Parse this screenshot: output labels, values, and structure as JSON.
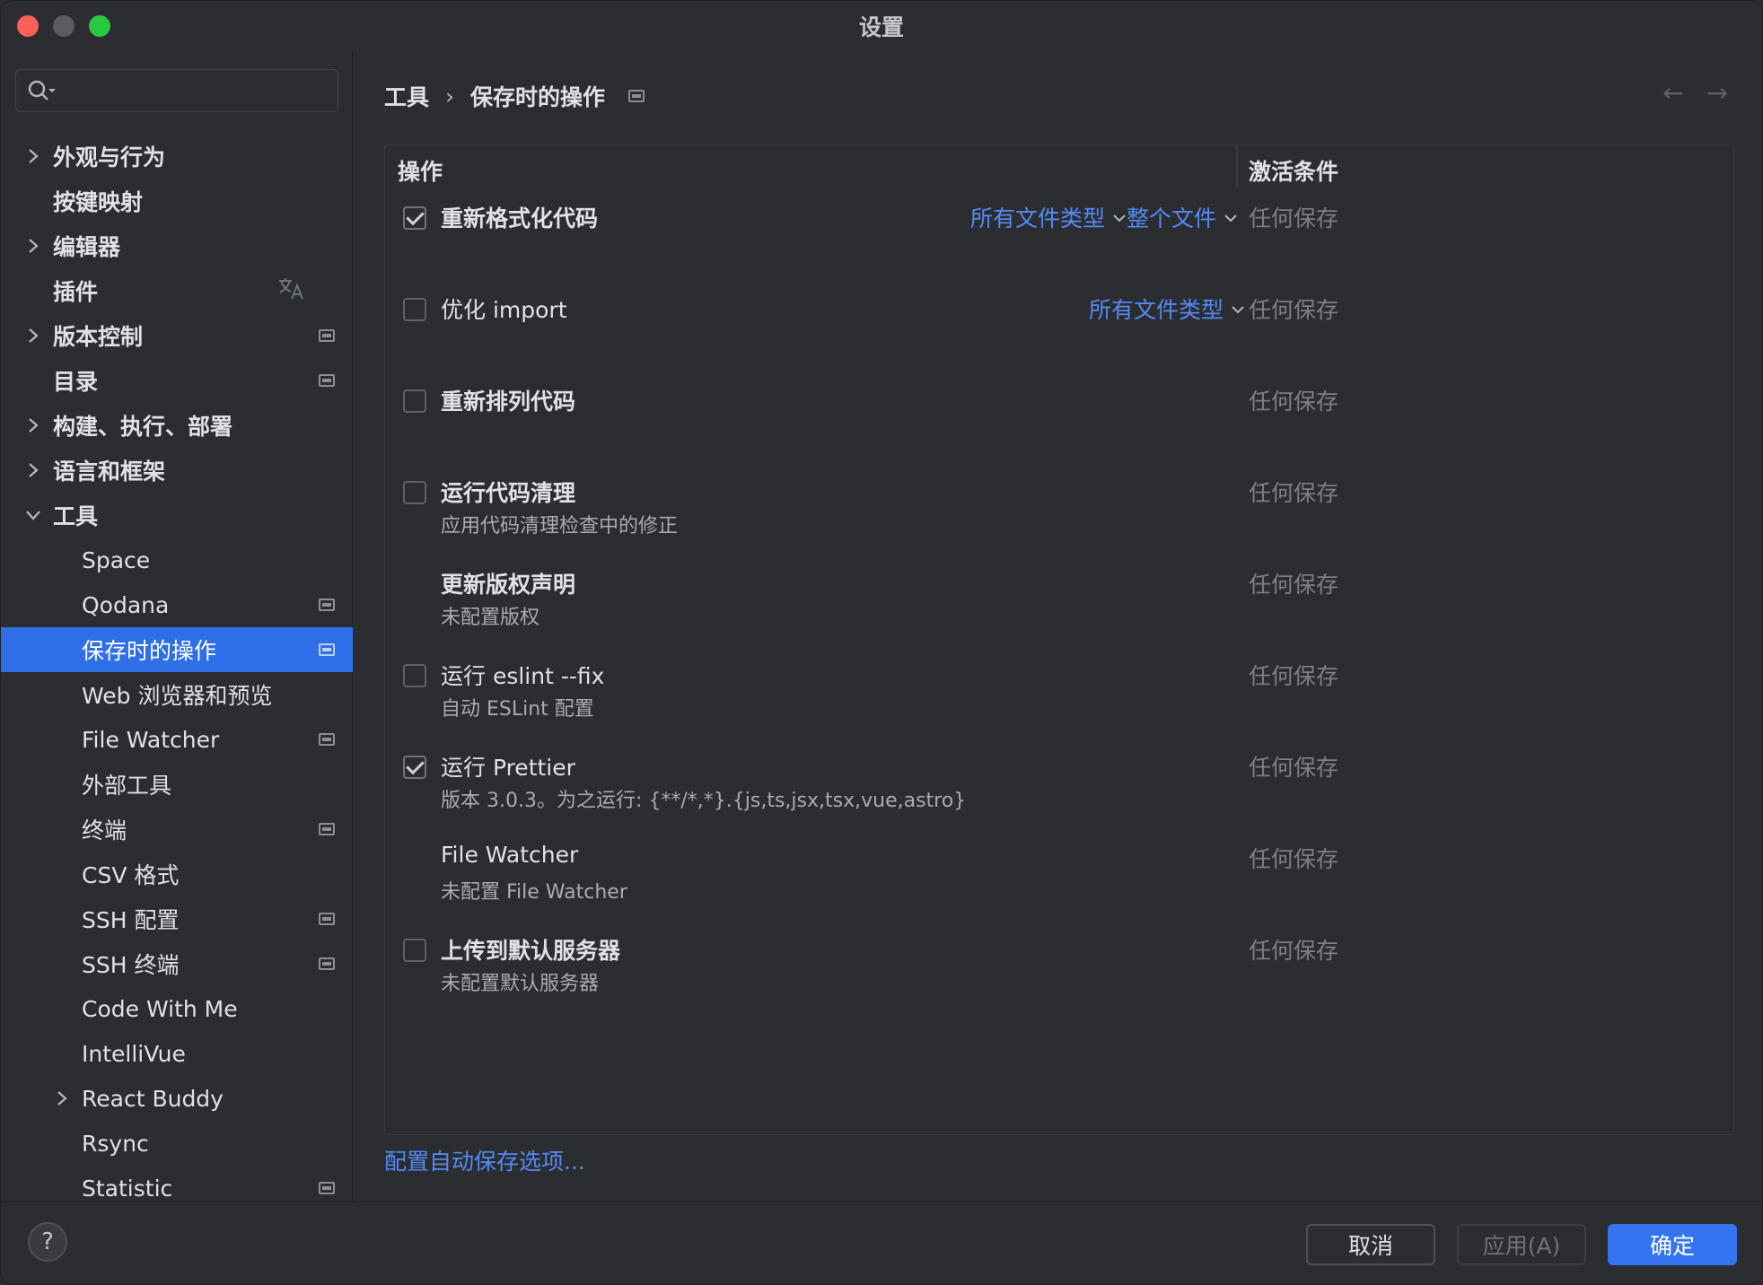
{
  "window": {
    "title": "设置"
  },
  "search": {
    "placeholder": "",
    "value": ""
  },
  "sidebar": {
    "items": [
      {
        "label": "外观与行为"
      },
      {
        "label": "按键映射"
      },
      {
        "label": "编辑器"
      },
      {
        "label": "插件"
      },
      {
        "label": "版本控制"
      },
      {
        "label": "目录"
      },
      {
        "label": "构建、执行、部署"
      },
      {
        "label": "语言和框架"
      },
      {
        "label": "工具"
      },
      {
        "label": "Space"
      },
      {
        "label": "Qodana"
      },
      {
        "label": "保存时的操作"
      },
      {
        "label": "Web 浏览器和预览"
      },
      {
        "label": "File Watcher"
      },
      {
        "label": "外部工具"
      },
      {
        "label": "终端"
      },
      {
        "label": "CSV 格式"
      },
      {
        "label": "SSH 配置"
      },
      {
        "label": "SSH 终端"
      },
      {
        "label": "Code With Me"
      },
      {
        "label": "IntelliVue"
      },
      {
        "label": "React Buddy"
      },
      {
        "label": "Rsync"
      },
      {
        "label": "Statistic"
      }
    ]
  },
  "breadcrumb": {
    "parent": "工具",
    "current": "保存时的操作"
  },
  "table": {
    "col_operation": "操作",
    "col_activation": "激活条件",
    "rows": [
      {
        "name": "重新格式化代码",
        "sub": "",
        "condition": "任何保存",
        "dd1": "所有文件类型",
        "dd2": "整个文件"
      },
      {
        "name": "优化 import",
        "sub": "",
        "condition": "任何保存",
        "dd1": "所有文件类型"
      },
      {
        "name": "重新排列代码",
        "sub": "",
        "condition": "任何保存"
      },
      {
        "name": "运行代码清理",
        "sub": "应用代码清理检查中的修正",
        "condition": "任何保存"
      },
      {
        "name": "更新版权声明",
        "sub": "未配置版权",
        "condition": "任何保存"
      },
      {
        "name": "运行 eslint --fix",
        "sub": "自动 ESLint 配置",
        "condition": "任何保存"
      },
      {
        "name": "运行 Prettier",
        "sub": "版本 3.0.3。为之运行: {**/*,*}.{js,ts,jsx,tsx,vue,astro}",
        "condition": "任何保存"
      },
      {
        "name": "File Watcher",
        "sub": "未配置 File Watcher",
        "condition": "任何保存"
      },
      {
        "name": "上传到默认服务器",
        "sub": "未配置默认服务器",
        "condition": "任何保存"
      }
    ]
  },
  "footer_link": "配置自动保存选项...",
  "buttons": {
    "help": "?",
    "cancel": "取消",
    "apply": "应用(A)",
    "ok": "确定"
  },
  "colors": {
    "accent": "#3574f0",
    "link": "#548af7",
    "selected": "#2e6ee6",
    "background": "#2b2d30"
  }
}
